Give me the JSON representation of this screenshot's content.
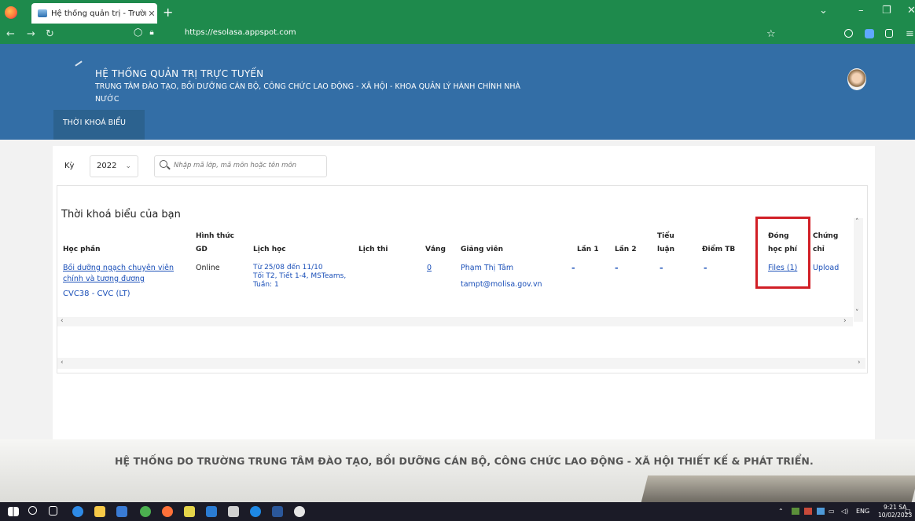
{
  "browser": {
    "tab_title": "Hệ thống quản trị - Trường Đào",
    "tab_close": "✕",
    "new_tab": "+",
    "url": "https://esolasa.appspot.com"
  },
  "site": {
    "title": "HỆ THỐNG QUẢN TRỊ TRỰC TUYẾN",
    "subtitle": "TRUNG TÂM ĐÀO TẠO, BỒI DƯỠNG CÁN BỘ, CÔNG CHỨC LAO ĐỘNG - XÃ HỘI - KHOA QUẢN LÝ HÀNH CHÍNH NHÀ NƯỚC",
    "nav_item": "THỜI KHOÁ BIỂU"
  },
  "filter": {
    "ky_label": "Kỳ",
    "year": "2022",
    "search_placeholder": "Nhập mã lớp, mã môn hoặc tên môn"
  },
  "table": {
    "title": "Thời khoá biểu của bạn",
    "headers": {
      "hoc_phan": "Học phần",
      "hinh_thuc_1": "Hình thức",
      "hinh_thuc_2": "GD",
      "lich_hoc": "Lịch học",
      "lich_thi": "Lịch thi",
      "vang": "Vắng",
      "giang_vien": "Giảng viên",
      "lan1": "Lần 1",
      "lan2": "Lần 2",
      "tieu_luan_1": "Tiểu",
      "tieu_luan_2": "luận",
      "diem_tb": "Điểm TB",
      "dong_hoc_phi_1": "Đóng",
      "dong_hoc_phi_2": "học phí",
      "chung_chi_1": "Chứng",
      "chung_chi_2": "chỉ"
    },
    "row": {
      "course_line1": "Bồi dưỡng ngạch chuyên viên",
      "course_line2": "chính và tương đương",
      "class_code": "CVC38 - CVC (LT)",
      "mode": "Online",
      "schedule_1": "Từ 25/08 đến 11/10",
      "schedule_2": "Tối T2, Tiết 1-4, MSTeams,",
      "schedule_3": "Tuần: 1",
      "absent": "0",
      "lecturer": "Phạm Thị Tâm",
      "email": "tampt@molisa.gov.vn",
      "lan1": "-",
      "lan2": "-",
      "tieu_luan": "-",
      "diem_tb": "-",
      "files": "Files (1)",
      "upload": "Upload"
    }
  },
  "footer": {
    "text": "HỆ THỐNG DO TRƯỜNG TRUNG TÂM ĐÀO TẠO, BỒI DƯỠNG CÁN BỘ, CÔNG CHỨC LAO ĐỘNG - XÃ HỘI THIẾT KẾ & PHÁT TRIỂN."
  },
  "taskbar": {
    "lang": "ENG",
    "time": "9:21 SA",
    "date": "10/02/2023"
  },
  "colors": {
    "browser_green": "#1e8a4c",
    "header_blue": "#336ea6",
    "link_blue": "#1a4fb8",
    "highlight_red": "#d11f26"
  }
}
